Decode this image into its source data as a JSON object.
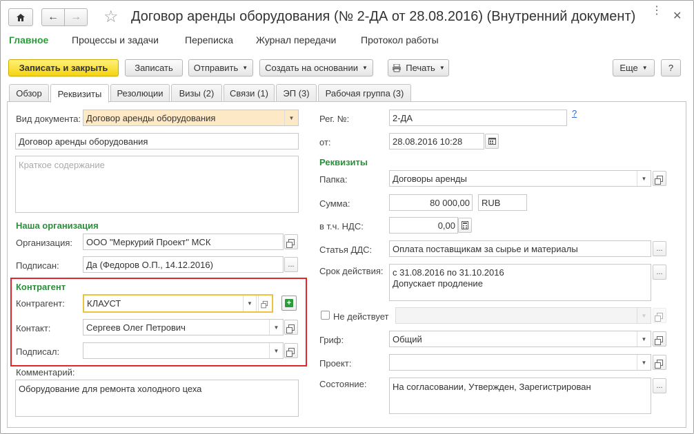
{
  "window": {
    "title": "Договор аренды оборудования (№ 2-ДА от 28.08.2016) (Внутренний документ)"
  },
  "nav": [
    "Главное",
    "Процессы и задачи",
    "Переписка",
    "Журнал передачи",
    "Протокол работы"
  ],
  "toolbar": {
    "save_close": "Записать и закрыть",
    "save": "Записать",
    "send": "Отправить",
    "create_based": "Создать на основании",
    "print": "Печать",
    "more": "Еще",
    "help": "?"
  },
  "tabs": [
    "Обзор",
    "Реквизиты",
    "Резолюции",
    "Визы (2)",
    "Связи (1)",
    "ЭП (3)",
    "Рабочая группа (3)"
  ],
  "left": {
    "doc_type_label": "Вид документа:",
    "doc_type": "Договор аренды оборудования",
    "title": "Договор аренды оборудования",
    "summary_placeholder": "Краткое содержание",
    "our_org_section": "Наша организация",
    "org_label": "Организация:",
    "org": "ООО \"Меркурий Проект\" МСК",
    "signed_label": "Подписан:",
    "signed": "Да (Федоров О.П., 14.12.2016)",
    "counterparty_section": "Контрагент",
    "counterparty_label": "Контрагент:",
    "counterparty": "КЛАУСТ",
    "contact_label": "Контакт:",
    "contact": "Сергеев Олег Петрович",
    "signed_by_label": "Подписал:",
    "signed_by": "",
    "comment_label": "Комментарий:",
    "comment": "Оборудование для ремонта холодного цеха"
  },
  "right": {
    "reg_label": "Рег. №:",
    "reg": "2-ДА",
    "reg_help": "?",
    "date_label": "от:",
    "date": "28.08.2016 10:28",
    "props_section": "Реквизиты",
    "folder_label": "Папка:",
    "folder": "Договоры аренды",
    "sum_label": "Сумма:",
    "sum": "80 000,00",
    "currency": "RUB",
    "vat_label": "в т.ч. НДС:",
    "vat": "0,00",
    "dds_label": "Статья ДДС:",
    "dds": "Оплата поставщикам за сырье и материалы",
    "term_label": "Срок действия:",
    "term_line1": "с 31.08.2016 по 31.10.2016",
    "term_line2": "Допускает продление",
    "inactive_label": "Не действует",
    "grif_label": "Гриф:",
    "grif": "Общий",
    "project_label": "Проект:",
    "project": "",
    "state_label": "Состояние:",
    "state": "На согласовании, Утвержден, Зарегистрирован"
  },
  "colors": {
    "accent_green": "#2a8f3a",
    "highlight_red": "#e0262b",
    "primary_yellow": "#f5d410"
  }
}
